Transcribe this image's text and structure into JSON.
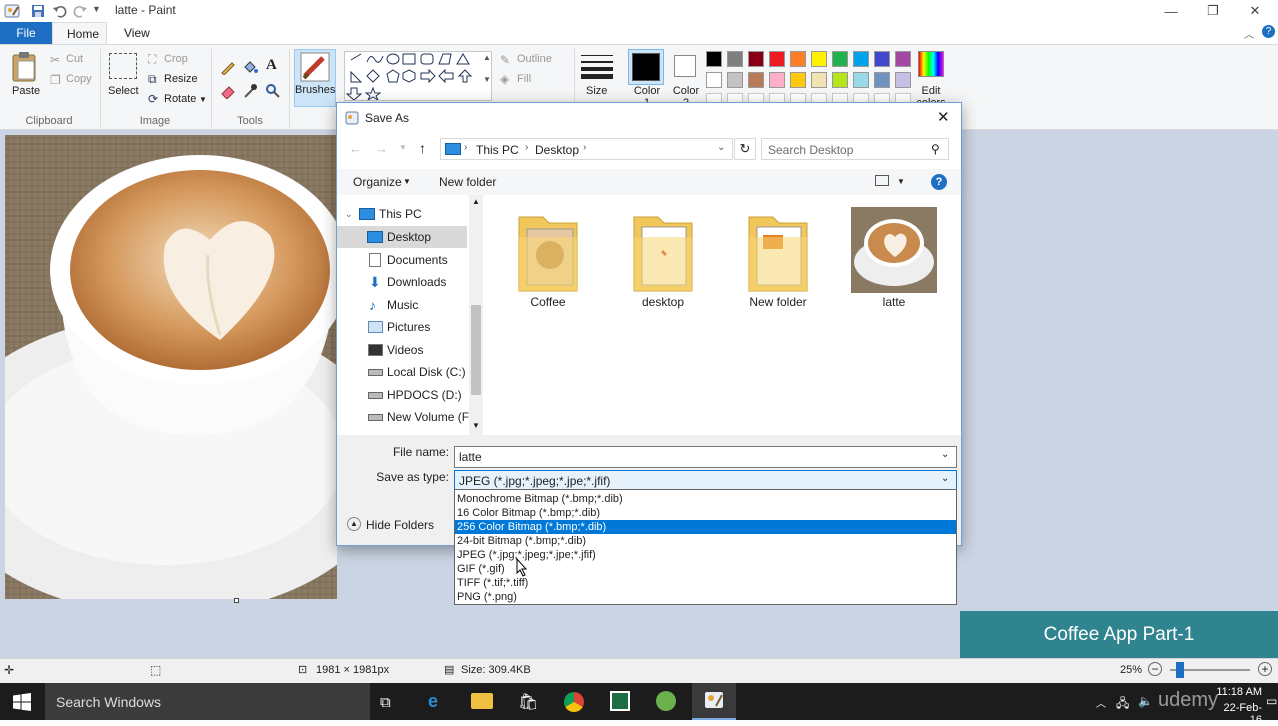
{
  "window": {
    "title": "latte - Paint"
  },
  "tabs": {
    "file": "File",
    "home": "Home",
    "view": "View"
  },
  "ribbon": {
    "clipboard": {
      "paste": "Paste",
      "cut": "Cut",
      "copy": "Copy",
      "group": "Clipboard"
    },
    "image": {
      "select": "Select",
      "crop": "Crop",
      "resize": "Resize",
      "rotate": "Rotate",
      "group": "Image"
    },
    "tools": {
      "group": "Tools"
    },
    "brushes": "Brushes",
    "shapes": {
      "outline": "Outline",
      "fill": "Fill"
    },
    "size": "Size",
    "color1": "Color 1",
    "color2": "Color 2",
    "edit_colors": "Edit colors",
    "palette": [
      "#000000",
      "#7f7f7f",
      "#880015",
      "#ed1c24",
      "#ff7f27",
      "#fff200",
      "#22b14c",
      "#00a2e8",
      "#3f48cc",
      "#a349a4",
      "#ffffff",
      "#c3c3c3",
      "#b97a57",
      "#ffaec9",
      "#ffc90e",
      "#efe4b0",
      "#b5e61d",
      "#99d9ea",
      "#7092be",
      "#c8bfe7"
    ]
  },
  "dialog": {
    "title": "Save As",
    "breadcrumb": [
      "This PC",
      "Desktop"
    ],
    "search_placeholder": "Search Desktop",
    "organize": "Organize",
    "new_folder": "New folder",
    "nav": [
      {
        "label": "This PC",
        "icon": "pc-icon"
      },
      {
        "label": "Desktop",
        "icon": "desktop-icon"
      },
      {
        "label": "Documents",
        "icon": "documents-icon"
      },
      {
        "label": "Downloads",
        "icon": "downloads-icon"
      },
      {
        "label": "Music",
        "icon": "music-icon"
      },
      {
        "label": "Pictures",
        "icon": "pictures-icon"
      },
      {
        "label": "Videos",
        "icon": "videos-icon"
      },
      {
        "label": "Local Disk (C:)",
        "icon": "drive-icon"
      },
      {
        "label": "HPDOCS (D:)",
        "icon": "drive-icon"
      },
      {
        "label": "New Volume (F:)",
        "icon": "drive-icon"
      }
    ],
    "files": [
      {
        "name": "Coffee",
        "type": "folder"
      },
      {
        "name": "desktop",
        "type": "folder"
      },
      {
        "name": "New folder",
        "type": "folder"
      },
      {
        "name": "latte",
        "type": "image"
      }
    ],
    "file_name_label": "File name:",
    "file_name_value": "latte",
    "save_type_label": "Save as type:",
    "save_type_value": "JPEG (*.jpg;*.jpeg;*.jpe;*.jfif)",
    "hide_folders": "Hide Folders",
    "type_options": [
      "Monochrome Bitmap (*.bmp;*.dib)",
      "16 Color Bitmap (*.bmp;*.dib)",
      "256 Color Bitmap (*.bmp;*.dib)",
      "24-bit Bitmap (*.bmp;*.dib)",
      "JPEG (*.jpg;*.jpeg;*.jpe;*.jfif)",
      "GIF (*.gif)",
      "TIFF (*.tif;*.tiff)",
      "PNG (*.png)"
    ],
    "highlighted_index": 2
  },
  "status": {
    "dimensions": "1981 × 1981px",
    "size": "Size: 309.4KB",
    "zoom": "25%"
  },
  "promo": "Coffee App Part-1",
  "taskbar": {
    "search": "Search Windows",
    "time": "11:18 AM",
    "date": "22-Feb-16",
    "watermark": "udemy"
  }
}
